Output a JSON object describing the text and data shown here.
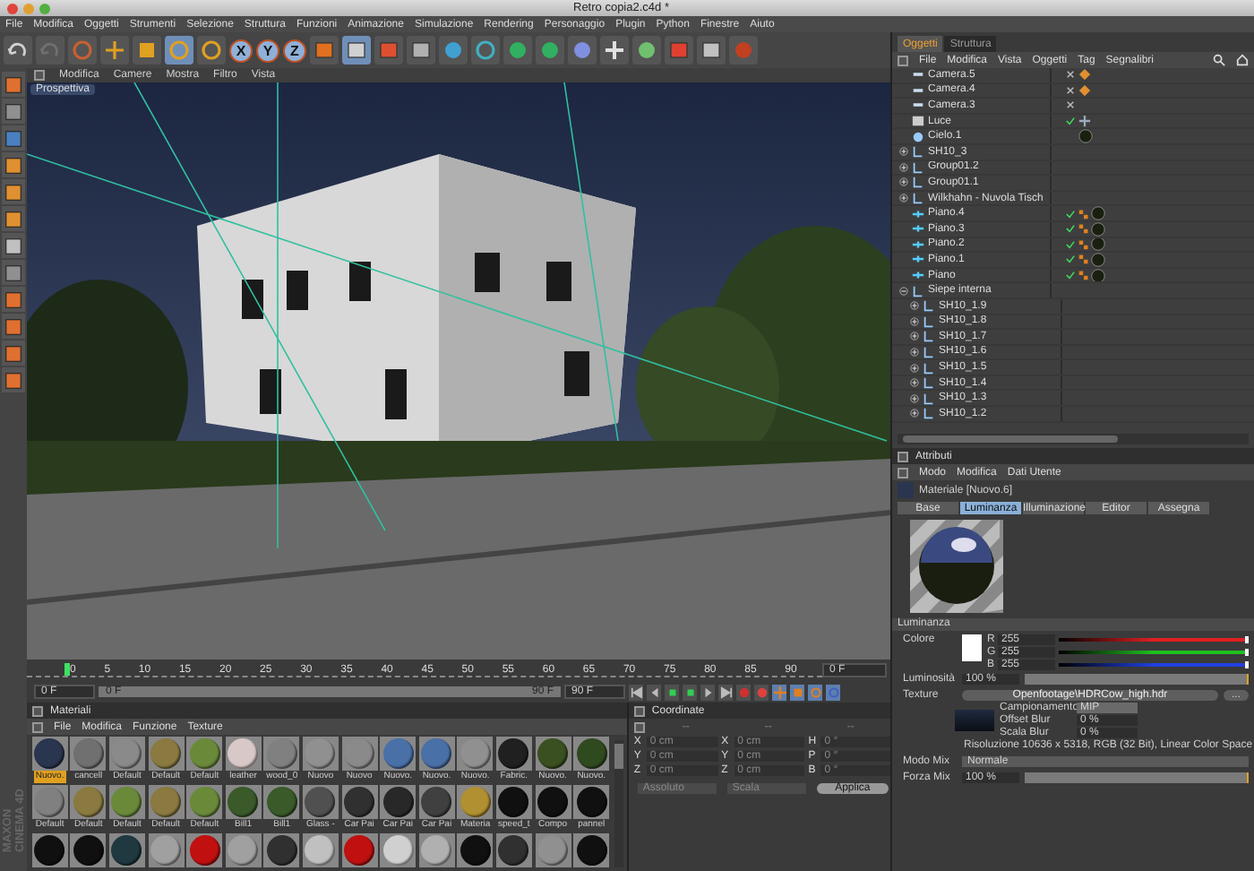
{
  "window": {
    "title": "Retro copia2.c4d *"
  },
  "menu_bar": [
    "File",
    "Modifica",
    "Oggetti",
    "Strumenti",
    "Selezione",
    "Struttura",
    "Funzioni",
    "Animazione",
    "Simulazione",
    "Rendering",
    "Personaggio",
    "Plugin",
    "Python",
    "Finestre",
    "Aiuto"
  ],
  "toolbar": {
    "axis_buttons": [
      {
        "label": "X",
        "on": true
      },
      {
        "label": "Y",
        "on": true
      },
      {
        "label": "Z",
        "on": true
      }
    ]
  },
  "viewport": {
    "menu": [
      "Modifica",
      "Camere",
      "Mostra",
      "Filtro",
      "Vista"
    ],
    "view_label": "Prospettiva"
  },
  "timeline": {
    "ticks": [
      "0",
      "5",
      "10",
      "15",
      "20",
      "25",
      "30",
      "35",
      "40",
      "45",
      "50",
      "55",
      "60",
      "65",
      "70",
      "75",
      "80",
      "85",
      "90"
    ],
    "current_frame": "0 F",
    "start_field": "0 F",
    "range": {
      "start": "0 F",
      "end": "90 F",
      "level": 1
    },
    "end_field": "90 F"
  },
  "materials": {
    "title": "Materiali",
    "menu": [
      "File",
      "Modifica",
      "Funzione",
      "Texture"
    ],
    "items": [
      {
        "label": "Nuovo.",
        "color": "#2a3550",
        "selected": true
      },
      {
        "label": "cancell",
        "color": "#707070",
        "selected": false
      },
      {
        "label": "Default",
        "color": "#8a8a8a",
        "selected": false
      },
      {
        "label": "Default",
        "color": "#8a7a40",
        "selected": false
      },
      {
        "label": "Default",
        "color": "#6a8a3a",
        "selected": false
      },
      {
        "label": "leather",
        "color": "#d8c8c8",
        "selected": false
      },
      {
        "label": "wood_0",
        "color": "#808080",
        "selected": false
      },
      {
        "label": "Nuovo",
        "color": "#909090",
        "selected": false
      },
      {
        "label": "Nuovo",
        "color": "#8a8a8a",
        "selected": false
      },
      {
        "label": "Nuovo.",
        "color": "#4a70a8",
        "selected": false
      },
      {
        "label": "Nuovo.",
        "color": "#4a70a8",
        "selected": false
      },
      {
        "label": "Nuovo.",
        "color": "#909090",
        "selected": false
      },
      {
        "label": "Fabric.",
        "color": "#202020",
        "selected": false
      },
      {
        "label": "Nuovo.",
        "color": "#3a5020",
        "selected": false
      },
      {
        "label": "Nuovo.",
        "color": "#304a20",
        "selected": false
      },
      {
        "label": "Default",
        "color": "#808080",
        "selected": false
      },
      {
        "label": "Default",
        "color": "#8a7a40",
        "selected": false
      },
      {
        "label": "Default",
        "color": "#6a8a3a",
        "selected": false
      },
      {
        "label": "Default",
        "color": "#8a7a40",
        "selected": false
      },
      {
        "label": "Default",
        "color": "#6a8a3a",
        "selected": false
      },
      {
        "label": "Bill1",
        "color": "#3a5a2a",
        "selected": false
      },
      {
        "label": "Bill1",
        "color": "#3a5a2a",
        "selected": false
      },
      {
        "label": "Glass -",
        "color": "#505050",
        "selected": false
      },
      {
        "label": "Car Pai",
        "color": "#303030",
        "selected": false
      },
      {
        "label": "Car Pai",
        "color": "#282828",
        "selected": false
      },
      {
        "label": "Car Pai",
        "color": "#404040",
        "selected": false
      },
      {
        "label": "Materia",
        "color": "#b09030",
        "selected": false
      },
      {
        "label": "speed_t",
        "color": "#101010",
        "selected": false
      },
      {
        "label": "Compo",
        "color": "#101010",
        "selected": false
      },
      {
        "label": "pannel",
        "color": "#101010",
        "selected": false
      },
      {
        "color": "#101010",
        "selected": false
      },
      {
        "color": "#101010",
        "selected": false
      },
      {
        "color": "#203840",
        "selected": false
      },
      {
        "color": "#a0a0a0",
        "selected": false
      },
      {
        "color": "#c01010",
        "selected": false
      },
      {
        "color": "#a0a0a0",
        "selected": false
      },
      {
        "color": "#303030",
        "selected": false
      },
      {
        "color": "#c0c0c0",
        "selected": false
      },
      {
        "color": "#c01010",
        "selected": false
      },
      {
        "color": "#d0d0d0",
        "selected": false
      },
      {
        "color": "#b0b0b0",
        "selected": false
      },
      {
        "color": "#101010",
        "selected": false
      },
      {
        "color": "#303030",
        "selected": false
      },
      {
        "color": "#909090",
        "selected": false
      },
      {
        "color": "#101010",
        "selected": false
      }
    ]
  },
  "coordinates": {
    "title": "Coordinate",
    "columns": [
      "--",
      "--",
      "--"
    ],
    "rows": [
      {
        "axis": "X",
        "position": "0 cm",
        "size_axis": "X",
        "size": "0 cm",
        "rotation_axis": "H",
        "rotation": "0 °"
      },
      {
        "axis": "Y",
        "position": "0 cm",
        "size_axis": "Y",
        "size": "0 cm",
        "rotation_axis": "P",
        "rotation": "0 °"
      },
      {
        "axis": "Z",
        "position": "0 cm",
        "size_axis": "Z",
        "size": "0 cm",
        "rotation_axis": "B",
        "rotation": "0 °"
      }
    ],
    "mode": "Assoluto",
    "size_mode": "Scala",
    "apply": "Applica"
  },
  "brand": [
    "MAXON",
    "CINEMA 4D"
  ],
  "objects_panel": {
    "tabs": [
      {
        "label": "Oggetti",
        "selected": true
      },
      {
        "label": "Struttura",
        "selected": false
      }
    ],
    "menu": [
      "File",
      "Modifica",
      "Vista",
      "Oggetti",
      "Tag",
      "Segnalibri"
    ],
    "objects": [
      {
        "name": "Camera.5",
        "kind": "camera",
        "enabled": false,
        "tags": [
          {
            "kind": "target"
          }
        ]
      },
      {
        "name": "Camera.4",
        "kind": "camera",
        "enabled": false,
        "tags": [
          {
            "kind": "target"
          }
        ]
      },
      {
        "name": "Camera.3",
        "kind": "camera",
        "enabled": false
      },
      {
        "name": "Luce",
        "kind": "light",
        "enabled": true,
        "tags": [
          {
            "kind": "light"
          }
        ]
      },
      {
        "name": "Cielo.1",
        "kind": "sky",
        "tags": [
          {
            "kind": "material"
          }
        ]
      },
      {
        "name": "SH10_3",
        "kind": "group",
        "expanded": false
      },
      {
        "name": "Group01.2",
        "kind": "group",
        "expanded": false
      },
      {
        "name": "Group01.1",
        "kind": "group",
        "expanded": false
      },
      {
        "name": "Wilkhahn - Nuvola Tisch",
        "kind": "group",
        "expanded": false
      },
      {
        "name": "Piano.4",
        "kind": "plane",
        "enabled": true,
        "tags": [
          {
            "kind": "texture"
          },
          {
            "kind": "material"
          }
        ]
      },
      {
        "name": "Piano.3",
        "kind": "plane",
        "enabled": true,
        "tags": [
          {
            "kind": "texture"
          },
          {
            "kind": "material"
          }
        ]
      },
      {
        "name": "Piano.2",
        "kind": "plane",
        "enabled": true,
        "tags": [
          {
            "kind": "texture"
          },
          {
            "kind": "material"
          }
        ]
      },
      {
        "name": "Piano.1",
        "kind": "plane",
        "enabled": true,
        "tags": [
          {
            "kind": "texture"
          },
          {
            "kind": "material"
          }
        ]
      },
      {
        "name": "Piano",
        "kind": "plane",
        "enabled": true,
        "tags": [
          {
            "kind": "texture"
          },
          {
            "kind": "material"
          }
        ]
      },
      {
        "name": "Siepe interna",
        "kind": "group",
        "expanded": true,
        "children": [
          {
            "name": "SH10_1.9",
            "expanded": false
          },
          {
            "name": "SH10_1.8",
            "expanded": false
          },
          {
            "name": "SH10_1.7",
            "expanded": false
          },
          {
            "name": "SH10_1.6",
            "expanded": false
          },
          {
            "name": "SH10_1.5",
            "expanded": false
          },
          {
            "name": "SH10_1.4",
            "expanded": false
          },
          {
            "name": "SH10_1.3",
            "expanded": false
          },
          {
            "name": "SH10_1.2",
            "expanded": false
          }
        ]
      }
    ]
  },
  "attributes": {
    "title": "Attributi",
    "menu": [
      "Modo",
      "Modifica",
      "Dati Utente"
    ],
    "material": "Materiale [Nuovo.6]",
    "tabs": [
      {
        "label": "Base",
        "selected": false
      },
      {
        "label": "Luminanza",
        "selected": true
      },
      {
        "label": "Illuminazione",
        "selected": false
      },
      {
        "label": "Editor",
        "selected": false
      },
      {
        "label": "Assegna",
        "selected": false
      }
    ],
    "section": "Luminanza",
    "color": {
      "label": "Colore",
      "channels": [
        {
          "name": "R",
          "value": "255",
          "level": 1,
          "color": "#e02020"
        },
        {
          "name": "G",
          "value": "255",
          "level": 1,
          "color": "#20c020"
        },
        {
          "name": "B",
          "value": "255",
          "level": 1,
          "color": "#2040e0"
        }
      ]
    },
    "brightness": {
      "label": "Luminosità",
      "value": "100 %",
      "level": 1
    },
    "texture": {
      "label": "Texture",
      "file": "Openfootage\\HDRCow_high.hdr",
      "browse": "...",
      "sampling_label": "Campionamento",
      "sampling": "MIP",
      "offset_blur_label": "Offset Blur",
      "offset_blur": "0 %",
      "scale_blur_label": "Scala Blur",
      "scale_blur": "0 %",
      "resolution": "Risoluzione 10636 x 5318, RGB (32 Bit), Linear Color Space"
    },
    "mix_mode": {
      "label": "Modo Mix",
      "value": "Normale"
    },
    "mix_strength": {
      "label": "Forza Mix",
      "value": "100 %",
      "level": 1
    }
  }
}
